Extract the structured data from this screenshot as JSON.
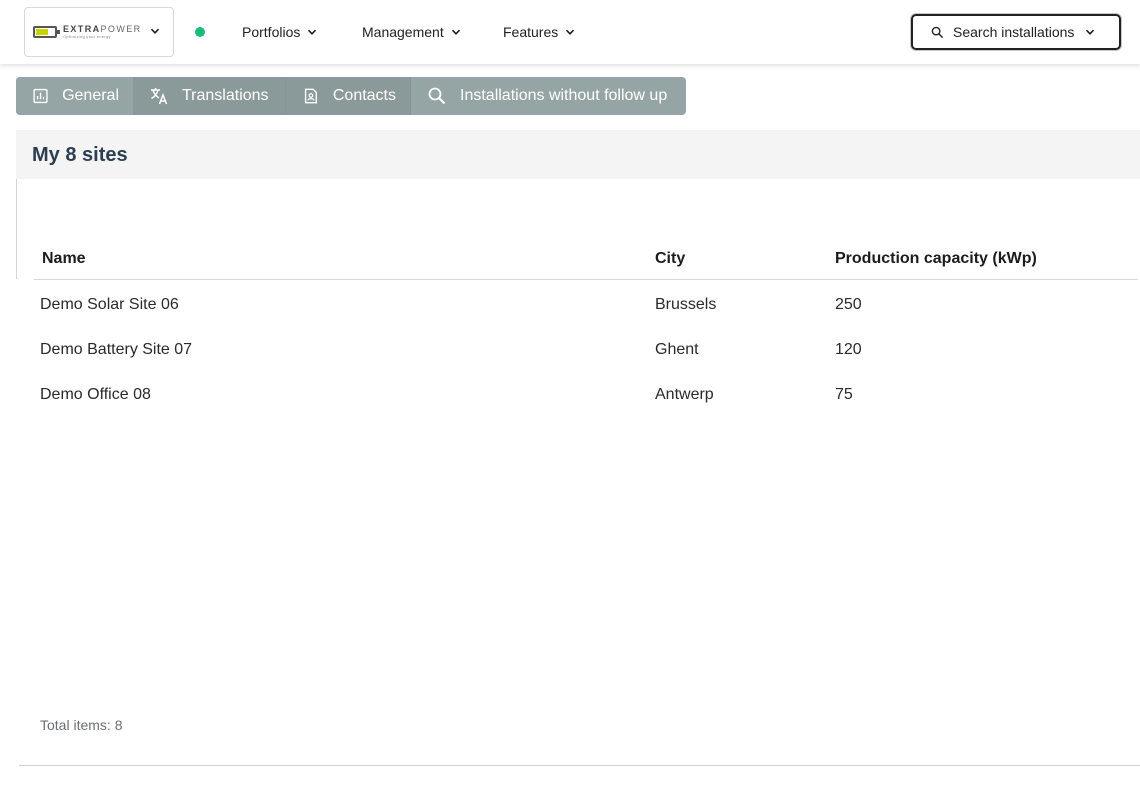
{
  "header": {
    "logo": {
      "brand_bold": "EXTRA",
      "brand_light": "POWER",
      "tagline": "Optimizing your energy"
    },
    "status_color": "#1dbb7b",
    "nav": [
      {
        "label": "Portfolios"
      },
      {
        "label": "Management"
      },
      {
        "label": "Features"
      }
    ],
    "search": {
      "label": "Search installations"
    }
  },
  "tabs": [
    {
      "label": "General",
      "icon": "bar-chart-icon"
    },
    {
      "label": "Translations",
      "icon": "translate-icon"
    },
    {
      "label": "Contacts",
      "icon": "contact-card-icon"
    },
    {
      "label": "Installations without follow up",
      "icon": "search-icon"
    }
  ],
  "card": {
    "title": "My 8 sites"
  },
  "table": {
    "columns": [
      "Name",
      "City",
      "Production capacity (kWp)"
    ],
    "rows": [
      {
        "name": "Demo Solar Site 06",
        "city": "Brussels",
        "capacity": "250"
      },
      {
        "name": "Demo Battery Site 07",
        "city": "Ghent",
        "capacity": "120"
      },
      {
        "name": "Demo Office 08",
        "city": "Antwerp",
        "capacity": "75"
      }
    ]
  },
  "footer": {
    "total": "Total items: 8"
  },
  "colors": {
    "tab_bar": "#95a5a6",
    "title": "#2c3e50",
    "accent_battery": "#c8d400"
  }
}
